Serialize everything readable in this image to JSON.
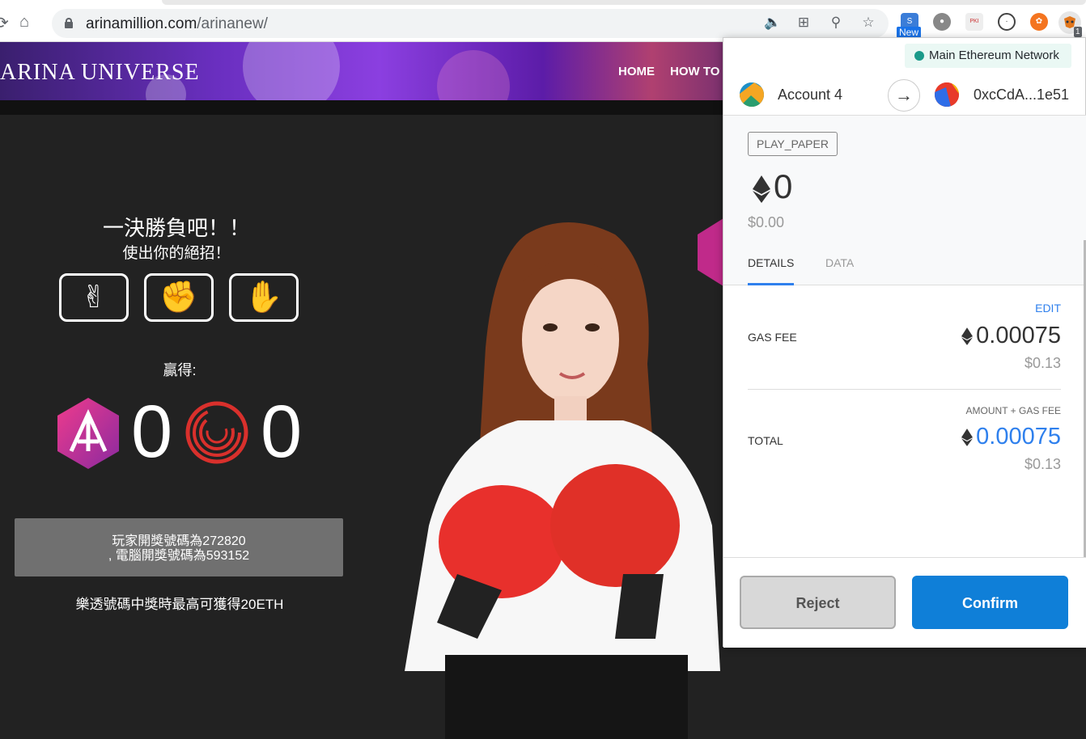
{
  "browser": {
    "url_domain": "arinamillion.com",
    "url_path": "/arinanew/",
    "new_badge": "New",
    "extension_count": "1"
  },
  "site": {
    "logo": "ARINA UNIVERSE",
    "nav": [
      "HOME",
      "HOW TO"
    ],
    "heading": "一決勝負吧！！",
    "subheading": "使出你的絕招！",
    "hands": [
      "scissors",
      "rock",
      "paper"
    ],
    "win_label": "贏得:",
    "player_score": "0",
    "computer_score": "0",
    "result_line1": "玩家開獎號碼為272820",
    "result_line2": ", 電腦開獎號碼為593152",
    "jackpot": "樂透號碼中獎時最高可獲得20ETH"
  },
  "metamask": {
    "network": "Main Ethereum Network",
    "from_account": "Account 4",
    "to_address": "0xcCdA...1e51",
    "method": "PLAY_PAPER",
    "amount_eth": "0",
    "amount_usd": "$0.00",
    "tabs": [
      "DETAILS",
      "DATA"
    ],
    "edit_label": "EDIT",
    "gas_fee_label": "GAS FEE",
    "gas_fee_eth": "0.00075",
    "gas_fee_usd": "$0.13",
    "amount_gas_label": "AMOUNT + GAS FEE",
    "total_label": "TOTAL",
    "total_eth": "0.00075",
    "total_usd": "$0.13",
    "reject_label": "Reject",
    "confirm_label": "Confirm"
  },
  "colors": {
    "accent_blue": "#0f7fd8",
    "network_dot": "#1a9a8a",
    "page_bg": "#222222"
  }
}
